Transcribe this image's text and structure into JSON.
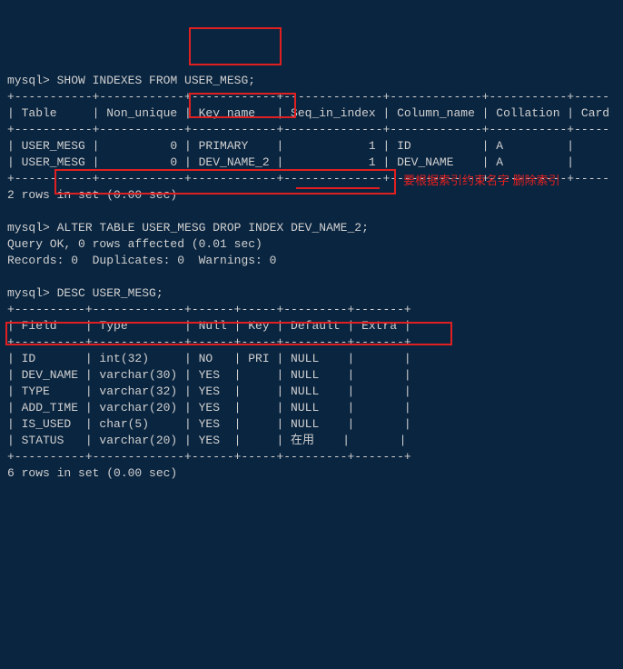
{
  "prompt": "mysql>",
  "cmd1": "SHOW INDEXES FROM USER_MESG;",
  "border1": "+-----------+------------+------------+--------------+-------------+-----------+-----",
  "header1": "| Table     | Non_unique | Key_name   | Seq_in_index | Column_name | Collation | Card",
  "row1a": "| USER_MESG |          0 | PRIMARY    |            1 | ID          | A         |     ",
  "row1b": "| USER_MESG |          0 | DEV_NAME_2 |            1 | DEV_NAME    | A         |     ",
  "result1": "2 rows in set (0.00 sec)",
  "cmd2": "ALTER TABLE USER_MESG DROP INDEX DEV_NAME_2;",
  "result2a": "Query OK, 0 rows affected (0.01 sec)",
  "result2b": "Records: 0  Duplicates: 0  Warnings: 0",
  "cmd3": "DESC USER_MESG;",
  "border3": "+----------+-------------+------+-----+---------+-------+",
  "header3": "| Field    | Type        | Null | Key | Default | Extra |",
  "row3a": "| ID       | int(32)     | NO   | PRI | NULL    |       |",
  "row3b": "| DEV_NAME | varchar(30) | YES  |     | NULL    |       |",
  "row3c": "| TYPE     | varchar(32) | YES  |     | NULL    |       |",
  "row3d": "| ADD_TIME | varchar(20) | YES  |     | NULL    |       |",
  "row3e": "| IS_USED  | char(5)     | YES  |     | NULL    |       |",
  "row3f": "| STATUS   | varchar(20) | YES  |     | 在用    |       |",
  "result3": "6 rows in set (0.00 sec)",
  "annotation": "要根据索引约束名字 删除索引",
  "chart_data": {
    "type": "table",
    "indexes": {
      "columns": [
        "Table",
        "Non_unique",
        "Key_name",
        "Seq_in_index",
        "Column_name",
        "Collation"
      ],
      "rows": [
        [
          "USER_MESG",
          0,
          "PRIMARY",
          1,
          "ID",
          "A"
        ],
        [
          "USER_MESG",
          0,
          "DEV_NAME_2",
          1,
          "DEV_NAME",
          "A"
        ]
      ]
    },
    "desc": {
      "columns": [
        "Field",
        "Type",
        "Null",
        "Key",
        "Default",
        "Extra"
      ],
      "rows": [
        [
          "ID",
          "int(32)",
          "NO",
          "PRI",
          "NULL",
          ""
        ],
        [
          "DEV_NAME",
          "varchar(30)",
          "YES",
          "",
          "NULL",
          ""
        ],
        [
          "TYPE",
          "varchar(32)",
          "YES",
          "",
          "NULL",
          ""
        ],
        [
          "ADD_TIME",
          "varchar(20)",
          "YES",
          "",
          "NULL",
          ""
        ],
        [
          "IS_USED",
          "char(5)",
          "YES",
          "",
          "NULL",
          ""
        ],
        [
          "STATUS",
          "varchar(20)",
          "YES",
          "",
          "在用",
          ""
        ]
      ]
    }
  }
}
